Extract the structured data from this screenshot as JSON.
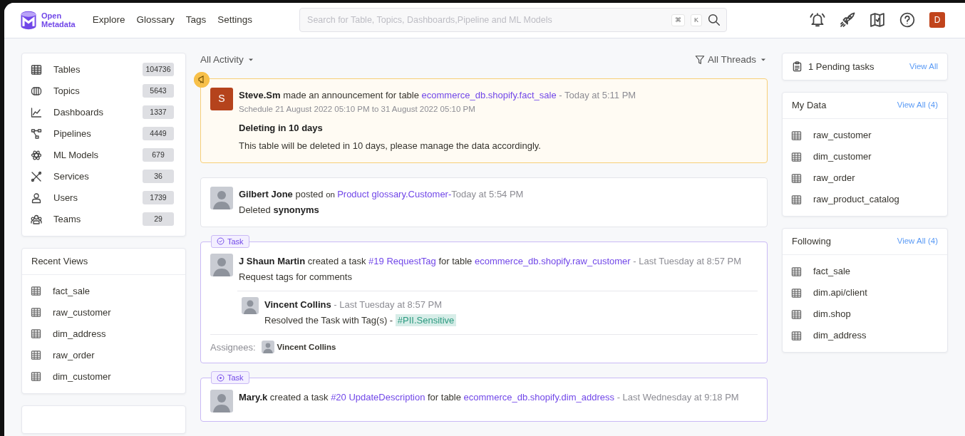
{
  "navbar": {
    "logo": [
      "Open",
      "Metadata"
    ],
    "menu": [
      "Explore",
      "Glossary",
      "Tags",
      "Settings"
    ],
    "search": {
      "placeholder": "Search for Table, Topics, Dashboards,Pipeline and ML Models",
      "keys": [
        "⌘",
        "K"
      ]
    },
    "user_initial": "D"
  },
  "entity_counts": [
    {
      "label": "Tables",
      "count": "104736"
    },
    {
      "label": "Topics",
      "count": "5643"
    },
    {
      "label": "Dashboards",
      "count": "1337"
    },
    {
      "label": "Pipelines",
      "count": "4449"
    },
    {
      "label": "ML Models",
      "count": "679"
    },
    {
      "label": "Services",
      "count": "36"
    },
    {
      "label": "Users",
      "count": "1739"
    },
    {
      "label": "Teams",
      "count": "29"
    }
  ],
  "recent_views": {
    "title": "Recent Views",
    "items": [
      "fact_sale",
      "raw_customer",
      "dim_address",
      "raw_order",
      "dim_customer"
    ]
  },
  "feed": {
    "filter": "All Activity",
    "threads": "All Threads",
    "items": [
      {
        "kind": "announcement",
        "avatar": {
          "kind": "letter",
          "letter": "S",
          "color": "#b5431c"
        },
        "header": [
          {
            "kind": "bold",
            "text": "Steve.Sm"
          },
          {
            "kind": "text",
            "text": " made an announcement for table "
          },
          {
            "kind": "link",
            "text": "ecommerce_db.shopify.fact_sale"
          },
          {
            "kind": "muted",
            "text": "  - Today at 5:11 PM"
          }
        ],
        "schedule": "Schedule 21 August 2022 05:10 PM to 31 August 2022 05:10 PM",
        "title": "Deleting in 10 days",
        "body": "This table will be deleted in 10 days, please manage the data accordingly."
      },
      {
        "kind": "post",
        "avatar": {
          "kind": "photo"
        },
        "header": [
          {
            "kind": "bold",
            "text": "Gilbert Jone"
          },
          {
            "kind": "text",
            "text": "  posted "
          },
          {
            "kind": "small",
            "text": "on "
          },
          {
            "kind": "link",
            "text": "Product glossary.Customer-"
          },
          {
            "kind": "muted",
            "text": "Today at 5:54 PM"
          }
        ],
        "body": "Deleted **synonyms**"
      },
      {
        "kind": "task",
        "badge": "Task",
        "resolved": true,
        "avatar": {
          "kind": "photo"
        },
        "header": [
          {
            "kind": "bold",
            "text": "J Shaun Martin"
          },
          {
            "kind": "text",
            "text": " created a task "
          },
          {
            "kind": "link",
            "text": "#19 RequestTag"
          },
          {
            "kind": "text",
            "text": " for table "
          },
          {
            "kind": "link",
            "text": "ecommerce_db.shopify.raw_customer"
          },
          {
            "kind": "muted",
            "text": " - Last Tuesday at 8:57 PM"
          }
        ],
        "body": "Request tags for comments",
        "reply": {
          "avatar": {
            "kind": "photo"
          },
          "header": [
            {
              "kind": "bold",
              "text": "Vincent Collins"
            },
            {
              "kind": "muted",
              "text": " - Last Tuesday at 8:57 PM"
            }
          ],
          "text": "Resolved the Task with Tag(s) - ",
          "tag": "#PII.Sensitive"
        },
        "assignees_label": "Assignees:",
        "assignees": [
          {
            "name": "Vincent Collins"
          }
        ]
      },
      {
        "kind": "task",
        "badge": "Task",
        "resolved": false,
        "avatar": {
          "kind": "photo"
        },
        "header": [
          {
            "kind": "bold",
            "text": "Mary.k"
          },
          {
            "kind": "text",
            "text": " created a task "
          },
          {
            "kind": "link",
            "text": "#20 UpdateDescription"
          },
          {
            "kind": "text",
            "text": " for table "
          },
          {
            "kind": "link",
            "text": "ecommerce_db.shopify.dim_address"
          },
          {
            "kind": "muted",
            "text": " - Last Wednesday at 9:18 PM"
          }
        ]
      }
    ]
  },
  "pending_tasks": {
    "label": "1 Pending tasks",
    "link": "View All"
  },
  "my_data": {
    "title": "My Data",
    "link": "View All (4)",
    "items": [
      "raw_customer",
      "dim_customer",
      "raw_order",
      "raw_product_catalog"
    ]
  },
  "following": {
    "title": "Following",
    "link": "View All (4)",
    "items": [
      "fact_sale",
      "dim.api/client",
      "dim.shop",
      "dim_address"
    ]
  }
}
